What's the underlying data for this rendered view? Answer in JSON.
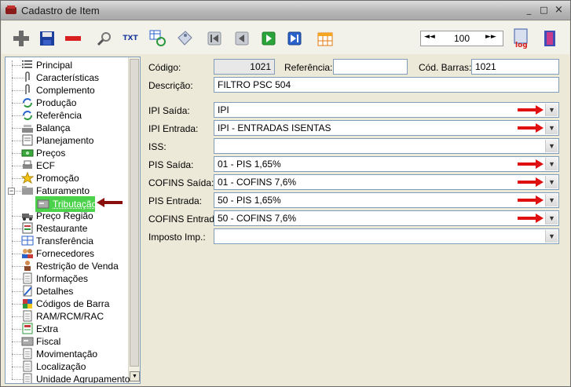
{
  "window": {
    "title": "Cadastro de Item",
    "minimize": "_",
    "maximize": "□",
    "close": "×"
  },
  "toolbar": {
    "txt_label": "TXT",
    "log_label": "log",
    "record_number": "100",
    "first": "◄◄",
    "next": "►►"
  },
  "tree": {
    "items": [
      {
        "label": "Principal",
        "icon": "list-icon"
      },
      {
        "label": "Características",
        "icon": "clip-icon"
      },
      {
        "label": "Complemento",
        "icon": "clip-icon"
      },
      {
        "label": "Produção",
        "icon": "refresh-icon"
      },
      {
        "label": "Referência",
        "icon": "refresh-icon"
      },
      {
        "label": "Balança",
        "icon": "scale-icon"
      },
      {
        "label": "Planejamento",
        "icon": "notepad-icon"
      },
      {
        "label": "Preços",
        "icon": "money-icon"
      },
      {
        "label": "ECF",
        "icon": "printer-icon"
      },
      {
        "label": "Promoção",
        "icon": "star-icon"
      },
      {
        "label": "Faturamento",
        "icon": "folder-icon"
      },
      {
        "label": "Tributação",
        "icon": "card-icon"
      },
      {
        "label": "Preço Região",
        "icon": "truck-icon"
      },
      {
        "label": "Restaurante",
        "icon": "menu-icon"
      },
      {
        "label": "Transferência",
        "icon": "grid-icon"
      },
      {
        "label": "Fornecedores",
        "icon": "people-icon"
      },
      {
        "label": "Restrição de Venda",
        "icon": "person-icon"
      },
      {
        "label": "Informações",
        "icon": "doc-icon"
      },
      {
        "label": "Detalhes",
        "icon": "pencil-icon"
      },
      {
        "label": "Códigos de Barra",
        "icon": "puzzle-icon"
      },
      {
        "label": "RAM/RCM/RAC",
        "icon": "doc-icon"
      },
      {
        "label": "Extra",
        "icon": "table-icon"
      },
      {
        "label": "Fiscal",
        "icon": "card-icon"
      },
      {
        "label": "Movimentação",
        "icon": "doc-icon"
      },
      {
        "label": "Localização",
        "icon": "doc-icon"
      },
      {
        "label": "Unidade Agrupamento",
        "icon": "doc-icon"
      }
    ]
  },
  "form": {
    "codigo_label": "Código:",
    "codigo_value": "1021",
    "referencia_label": "Referência:",
    "referencia_value": "",
    "cod_barras_label": "Cód. Barras:",
    "cod_barras_value": "1021",
    "descricao_label": "Descrição:",
    "descricao_value": "FILTRO PSC 504",
    "ipi_saida_label": "IPI Saída:",
    "ipi_saida_value": "IPI",
    "ipi_entrada_label": "IPI Entrada:",
    "ipi_entrada_value": "IPI - ENTRADAS ISENTAS",
    "iss_label": "ISS:",
    "iss_value": "",
    "pis_saida_label": "PIS Saída:",
    "pis_saida_value": "01 - PIS 1,65%",
    "cofins_saida_label": "COFINS Saída:",
    "cofins_saida_value": "01 - COFINS 7,6%",
    "pis_entrada_label": "PIS Entrada:",
    "pis_entrada_value": "50 - PIS 1,65%",
    "cofins_entrada_label": "COFINS Entrada:",
    "cofins_entrada_value": "50 - COFINS 7,6%",
    "imposto_imp_label": "Imposto Imp.:",
    "imposto_imp_value": ""
  },
  "colors": {
    "annotation_arrow": "#e01010",
    "selection": "#4ad24a"
  }
}
